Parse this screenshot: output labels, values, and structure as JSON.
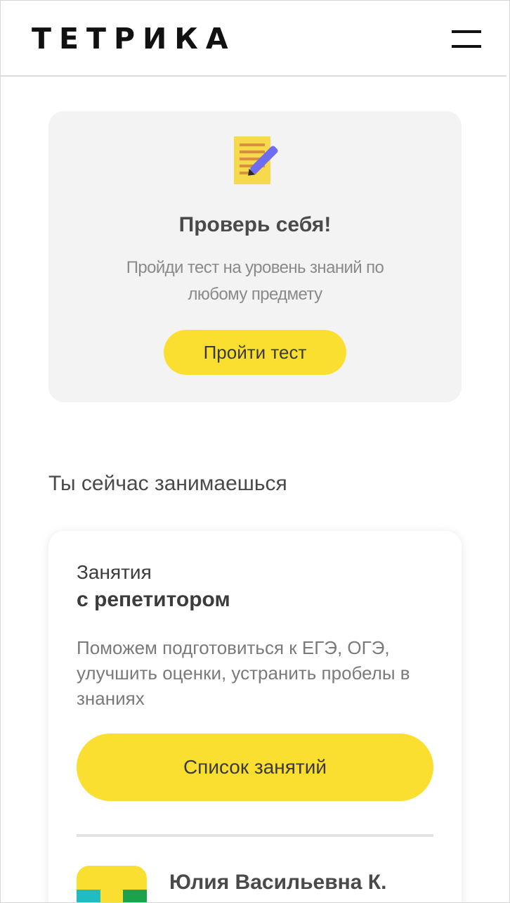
{
  "header": {
    "logo_text": "ТЕТРИКА",
    "menu_icon": "hamburger-menu-icon"
  },
  "test_card": {
    "icon": "notepad-pencil-icon",
    "title": "Проверь себя!",
    "description": "Пройди тест на уровень знаний по любому предмету",
    "button_label": "Пройти тест"
  },
  "current_section": {
    "title": "Ты сейчас занимаешься"
  },
  "lesson_card": {
    "kicker": "Занятия",
    "title": "с репетитором",
    "description": "Поможем подготовиться к ЕГЭ, ОГЭ, улучшить оценки, устранить пробелы в знаниях",
    "button_label": "Список занятий",
    "tutor": {
      "name": "Юлия Васильевна К.",
      "avatar_colors": [
        "#fbdf30",
        "#1fbcc4",
        "#1aa34a"
      ]
    }
  },
  "colors": {
    "accent_yellow": "#fbdf30",
    "card_gray": "#f3f3f3",
    "text_dark": "#4a4a4a"
  }
}
